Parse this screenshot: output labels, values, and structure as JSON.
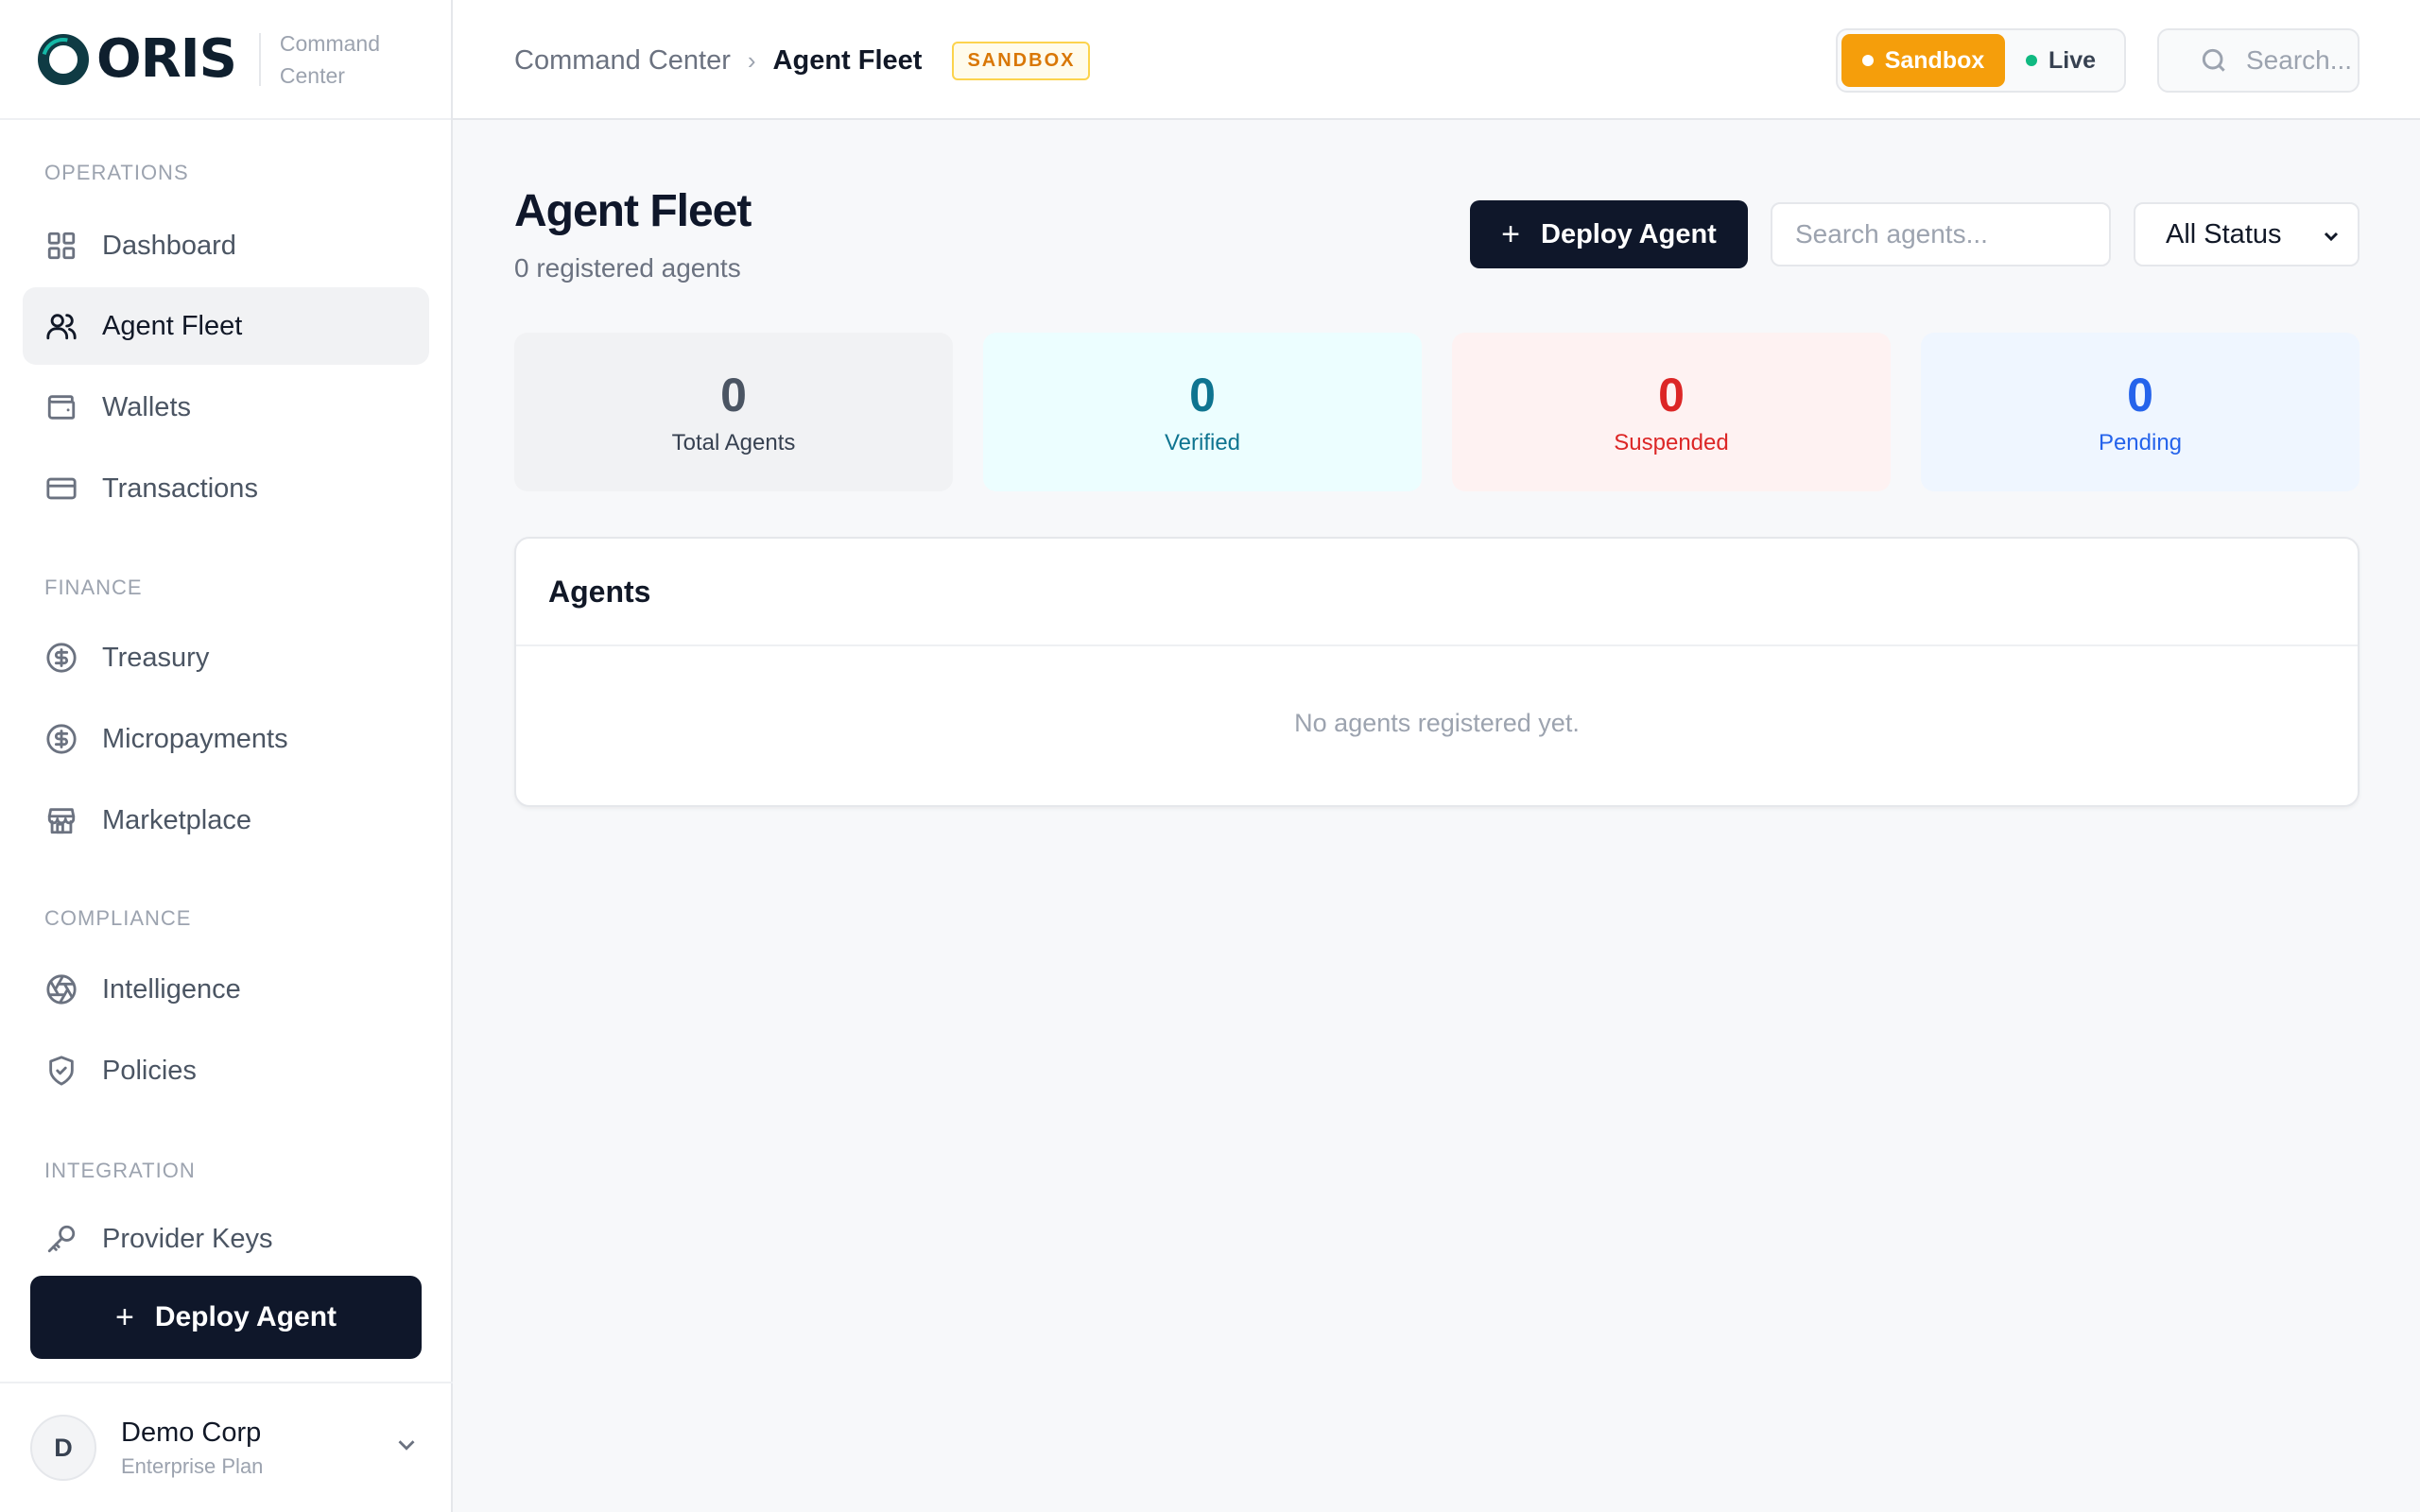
{
  "brand": {
    "logo_text": "ORIS",
    "subtitle": "Command Center"
  },
  "sidebar": {
    "sections": [
      {
        "label": "OPERATIONS",
        "items": [
          {
            "label": "Dashboard",
            "icon": "grid-icon",
            "active": false
          },
          {
            "label": "Agent Fleet",
            "icon": "users-icon",
            "active": true
          },
          {
            "label": "Wallets",
            "icon": "wallet-icon",
            "active": false
          },
          {
            "label": "Transactions",
            "icon": "credit-card-icon",
            "active": false
          }
        ]
      },
      {
        "label": "FINANCE",
        "items": [
          {
            "label": "Treasury",
            "icon": "dollar-circle-icon",
            "active": false
          },
          {
            "label": "Micropayments",
            "icon": "dollar-circle-icon",
            "active": false
          },
          {
            "label": "Marketplace",
            "icon": "store-icon",
            "active": false
          }
        ]
      },
      {
        "label": "COMPLIANCE",
        "items": [
          {
            "label": "Intelligence",
            "icon": "aperture-icon",
            "active": false
          },
          {
            "label": "Policies",
            "icon": "shield-icon",
            "active": false
          }
        ]
      },
      {
        "label": "INTEGRATION",
        "items": [
          {
            "label": "Provider Keys",
            "icon": "key-icon",
            "active": false
          }
        ]
      }
    ],
    "deploy_label": "Deploy Agent",
    "user": {
      "initial": "D",
      "name": "Demo Corp",
      "plan": "Enterprise Plan"
    }
  },
  "header": {
    "breadcrumb_root": "Command Center",
    "breadcrumb_sep": "›",
    "breadcrumb_current": "Agent Fleet",
    "env_badge": "SANDBOX",
    "env_options": [
      "Sandbox",
      "Live"
    ],
    "env_selected": "Sandbox",
    "search_placeholder": "Search..."
  },
  "main": {
    "title": "Agent Fleet",
    "subtitle": "0 registered agents",
    "deploy_label": "Deploy Agent",
    "search_placeholder": "Search agents...",
    "status_filter": "All Status",
    "stats": [
      {
        "value": "0",
        "label": "Total Agents"
      },
      {
        "value": "0",
        "label": "Verified"
      },
      {
        "value": "0",
        "label": "Suspended"
      },
      {
        "value": "0",
        "label": "Pending"
      }
    ],
    "agents_title": "Agents",
    "agents_empty": "No agents registered yet."
  },
  "colors": {
    "primary_dark": "#0f172a",
    "sandbox_accent": "#f59e0b",
    "live_dot": "#10b981",
    "verified": "#0e7490",
    "suspended": "#dc2626",
    "pending": "#2563eb"
  }
}
